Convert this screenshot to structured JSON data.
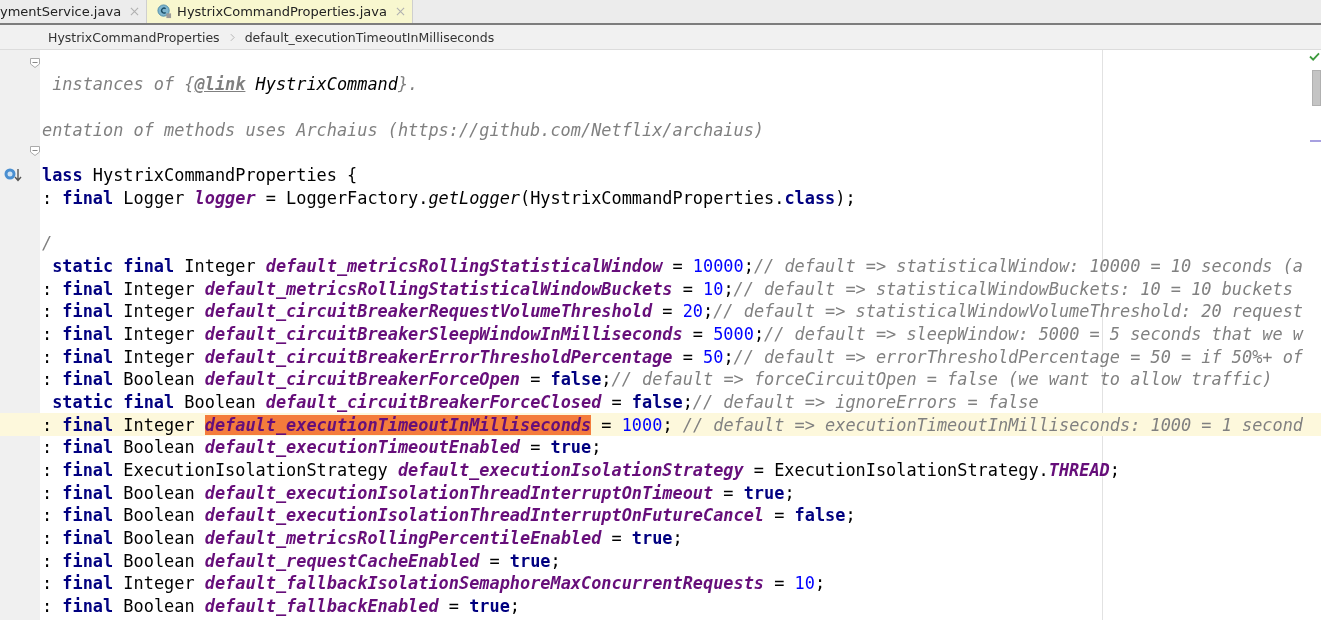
{
  "tabs": [
    {
      "label": "ymentService.java",
      "selected": false
    },
    {
      "label": "HystrixCommandProperties.java",
      "selected": true
    }
  ],
  "breadcrumb": [
    "HystrixCommandProperties",
    "default_executionTimeoutInMilliseconds"
  ],
  "lines": [
    {
      "tokens": [
        {
          "kind": "comment",
          "text": " instances of {"
        },
        {
          "kind": "doctag",
          "text": "@link"
        },
        {
          "kind": "docref",
          "text": " HystrixCommand"
        },
        {
          "kind": "comment",
          "text": "}."
        }
      ]
    },
    {
      "space_before": true,
      "tokens": [
        {
          "kind": "comment",
          "text": "entation of methods uses Archaius (https://github.com/Netflix/archaius)"
        }
      ]
    },
    {
      "space_before": true,
      "gutter_mark": true,
      "tokens": [
        {
          "kind": "kw",
          "text": "lass"
        },
        {
          "kind": "plain",
          "text": " HystrixCommandProperties {"
        }
      ]
    },
    {
      "tokens": [
        {
          "kind": "plain",
          "text": ": "
        },
        {
          "kind": "kw",
          "text": "final"
        },
        {
          "kind": "plain",
          "text": " Logger "
        },
        {
          "kind": "field",
          "text": "logger"
        },
        {
          "kind": "plain",
          "text": " = LoggerFactory."
        },
        {
          "kind": "call",
          "text": "getLogger"
        },
        {
          "kind": "plain",
          "text": "(HystrixCommandProperties."
        },
        {
          "kind": "kw",
          "text": "class"
        },
        {
          "kind": "plain",
          "text": ");"
        }
      ]
    },
    {
      "space_before": true,
      "tokens": [
        {
          "kind": "comment",
          "text": "/"
        }
      ]
    },
    {
      "tokens": [
        {
          "kind": "kw",
          "text": " static final"
        },
        {
          "kind": "plain",
          "text": " Integer "
        },
        {
          "kind": "field",
          "text": "default_metricsRollingStatisticalWindow"
        },
        {
          "kind": "plain",
          "text": " = "
        },
        {
          "kind": "num",
          "text": "10000"
        },
        {
          "kind": "plain",
          "text": ";"
        },
        {
          "kind": "comment",
          "text": "// default => statisticalWindow: 10000 = 10 seconds (a"
        }
      ]
    },
    {
      "tokens": [
        {
          "kind": "plain",
          "text": ": "
        },
        {
          "kind": "kw",
          "text": "final"
        },
        {
          "kind": "plain",
          "text": " Integer "
        },
        {
          "kind": "field",
          "text": "default_metricsRollingStatisticalWindowBuckets"
        },
        {
          "kind": "plain",
          "text": " = "
        },
        {
          "kind": "num",
          "text": "10"
        },
        {
          "kind": "plain",
          "text": ";"
        },
        {
          "kind": "comment",
          "text": "// default => statisticalWindowBuckets: 10 = 10 buckets"
        }
      ]
    },
    {
      "tokens": [
        {
          "kind": "plain",
          "text": ": "
        },
        {
          "kind": "kw",
          "text": "final"
        },
        {
          "kind": "plain",
          "text": " Integer "
        },
        {
          "kind": "field",
          "text": "default_circuitBreakerRequestVolumeThreshold"
        },
        {
          "kind": "plain",
          "text": " = "
        },
        {
          "kind": "num",
          "text": "20"
        },
        {
          "kind": "plain",
          "text": ";"
        },
        {
          "kind": "comment",
          "text": "// default => statisticalWindowVolumeThreshold: 20 request"
        }
      ]
    },
    {
      "tokens": [
        {
          "kind": "plain",
          "text": ": "
        },
        {
          "kind": "kw",
          "text": "final"
        },
        {
          "kind": "plain",
          "text": " Integer "
        },
        {
          "kind": "field",
          "text": "default_circuitBreakerSleepWindowInMilliseconds"
        },
        {
          "kind": "plain",
          "text": " = "
        },
        {
          "kind": "num",
          "text": "5000"
        },
        {
          "kind": "plain",
          "text": ";"
        },
        {
          "kind": "comment",
          "text": "// default => sleepWindow: 5000 = 5 seconds that we w"
        }
      ]
    },
    {
      "tokens": [
        {
          "kind": "plain",
          "text": ": "
        },
        {
          "kind": "kw",
          "text": "final"
        },
        {
          "kind": "plain",
          "text": " Integer "
        },
        {
          "kind": "field",
          "text": "default_circuitBreakerErrorThresholdPercentage"
        },
        {
          "kind": "plain",
          "text": " = "
        },
        {
          "kind": "num",
          "text": "50"
        },
        {
          "kind": "plain",
          "text": ";"
        },
        {
          "kind": "comment",
          "text": "// default => errorThresholdPercentage = 50 = if 50%+ of"
        }
      ]
    },
    {
      "tokens": [
        {
          "kind": "plain",
          "text": ": "
        },
        {
          "kind": "kw",
          "text": "final"
        },
        {
          "kind": "plain",
          "text": " Boolean "
        },
        {
          "kind": "field",
          "text": "default_circuitBreakerForceOpen"
        },
        {
          "kind": "plain",
          "text": " = "
        },
        {
          "kind": "kw",
          "text": "false"
        },
        {
          "kind": "plain",
          "text": ";"
        },
        {
          "kind": "comment",
          "text": "// default => forceCircuitOpen = false (we want to allow traffic)"
        }
      ]
    },
    {
      "tokens": [
        {
          "kind": "kw",
          "text": " static final"
        },
        {
          "kind": "plain",
          "text": " Boolean "
        },
        {
          "kind": "field",
          "text": "default_circuitBreakerForceClosed"
        },
        {
          "kind": "plain",
          "text": " = "
        },
        {
          "kind": "kw",
          "text": "false"
        },
        {
          "kind": "plain",
          "text": ";"
        },
        {
          "kind": "comment",
          "text": "// default => ignoreErrors = false"
        }
      ]
    },
    {
      "current": true,
      "tokens": [
        {
          "kind": "plain",
          "text": ": "
        },
        {
          "kind": "kw",
          "text": "final"
        },
        {
          "kind": "plain",
          "text": " Integer "
        },
        {
          "kind": "match",
          "text": "default_executionTimeoutInMilliseconds"
        },
        {
          "kind": "plain",
          "text": " = "
        },
        {
          "kind": "num",
          "text": "1000"
        },
        {
          "kind": "plain",
          "text": "; "
        },
        {
          "kind": "comment",
          "text": "// default => executionTimeoutInMilliseconds: 1000 = 1 second"
        }
      ]
    },
    {
      "tokens": [
        {
          "kind": "plain",
          "text": ": "
        },
        {
          "kind": "kw",
          "text": "final"
        },
        {
          "kind": "plain",
          "text": " Boolean "
        },
        {
          "kind": "field",
          "text": "default_executionTimeoutEnabled"
        },
        {
          "kind": "plain",
          "text": " = "
        },
        {
          "kind": "kw",
          "text": "true"
        },
        {
          "kind": "plain",
          "text": ";"
        }
      ]
    },
    {
      "tokens": [
        {
          "kind": "plain",
          "text": ": "
        },
        {
          "kind": "kw",
          "text": "final"
        },
        {
          "kind": "plain",
          "text": " ExecutionIsolationStrategy "
        },
        {
          "kind": "field",
          "text": "default_executionIsolationStrategy"
        },
        {
          "kind": "plain",
          "text": " = ExecutionIsolationStrategy."
        },
        {
          "kind": "field",
          "text": "THREAD"
        },
        {
          "kind": "plain",
          "text": ";"
        }
      ]
    },
    {
      "tokens": [
        {
          "kind": "plain",
          "text": ": "
        },
        {
          "kind": "kw",
          "text": "final"
        },
        {
          "kind": "plain",
          "text": " Boolean "
        },
        {
          "kind": "field",
          "text": "default_executionIsolationThreadInterruptOnTimeout"
        },
        {
          "kind": "plain",
          "text": " = "
        },
        {
          "kind": "kw",
          "text": "true"
        },
        {
          "kind": "plain",
          "text": ";"
        }
      ]
    },
    {
      "tokens": [
        {
          "kind": "plain",
          "text": ": "
        },
        {
          "kind": "kw",
          "text": "final"
        },
        {
          "kind": "plain",
          "text": " Boolean "
        },
        {
          "kind": "field",
          "text": "default_executionIsolationThreadInterruptOnFutureCancel"
        },
        {
          "kind": "plain",
          "text": " = "
        },
        {
          "kind": "kw",
          "text": "false"
        },
        {
          "kind": "plain",
          "text": ";"
        }
      ]
    },
    {
      "tokens": [
        {
          "kind": "plain",
          "text": ": "
        },
        {
          "kind": "kw",
          "text": "final"
        },
        {
          "kind": "plain",
          "text": " Boolean "
        },
        {
          "kind": "field",
          "text": "default_metricsRollingPercentileEnabled"
        },
        {
          "kind": "plain",
          "text": " = "
        },
        {
          "kind": "kw",
          "text": "true"
        },
        {
          "kind": "plain",
          "text": ";"
        }
      ]
    },
    {
      "tokens": [
        {
          "kind": "plain",
          "text": ": "
        },
        {
          "kind": "kw",
          "text": "final"
        },
        {
          "kind": "plain",
          "text": " Boolean "
        },
        {
          "kind": "field",
          "text": "default_requestCacheEnabled"
        },
        {
          "kind": "plain",
          "text": " = "
        },
        {
          "kind": "kw",
          "text": "true"
        },
        {
          "kind": "plain",
          "text": ";"
        }
      ]
    },
    {
      "tokens": [
        {
          "kind": "plain",
          "text": ": "
        },
        {
          "kind": "kw",
          "text": "final"
        },
        {
          "kind": "plain",
          "text": " Integer "
        },
        {
          "kind": "field",
          "text": "default_fallbackIsolationSemaphoreMaxConcurrentRequests"
        },
        {
          "kind": "plain",
          "text": " = "
        },
        {
          "kind": "num",
          "text": "10"
        },
        {
          "kind": "plain",
          "text": ";"
        }
      ]
    },
    {
      "tokens": [
        {
          "kind": "plain",
          "text": ": "
        },
        {
          "kind": "kw",
          "text": "final"
        },
        {
          "kind": "plain",
          "text": " Boolean "
        },
        {
          "kind": "field",
          "text": "default_fallbackEnabled"
        },
        {
          "kind": "plain",
          "text": " = "
        },
        {
          "kind": "kw",
          "text": "true"
        },
        {
          "kind": "plain",
          "text": ";"
        }
      ]
    }
  ]
}
